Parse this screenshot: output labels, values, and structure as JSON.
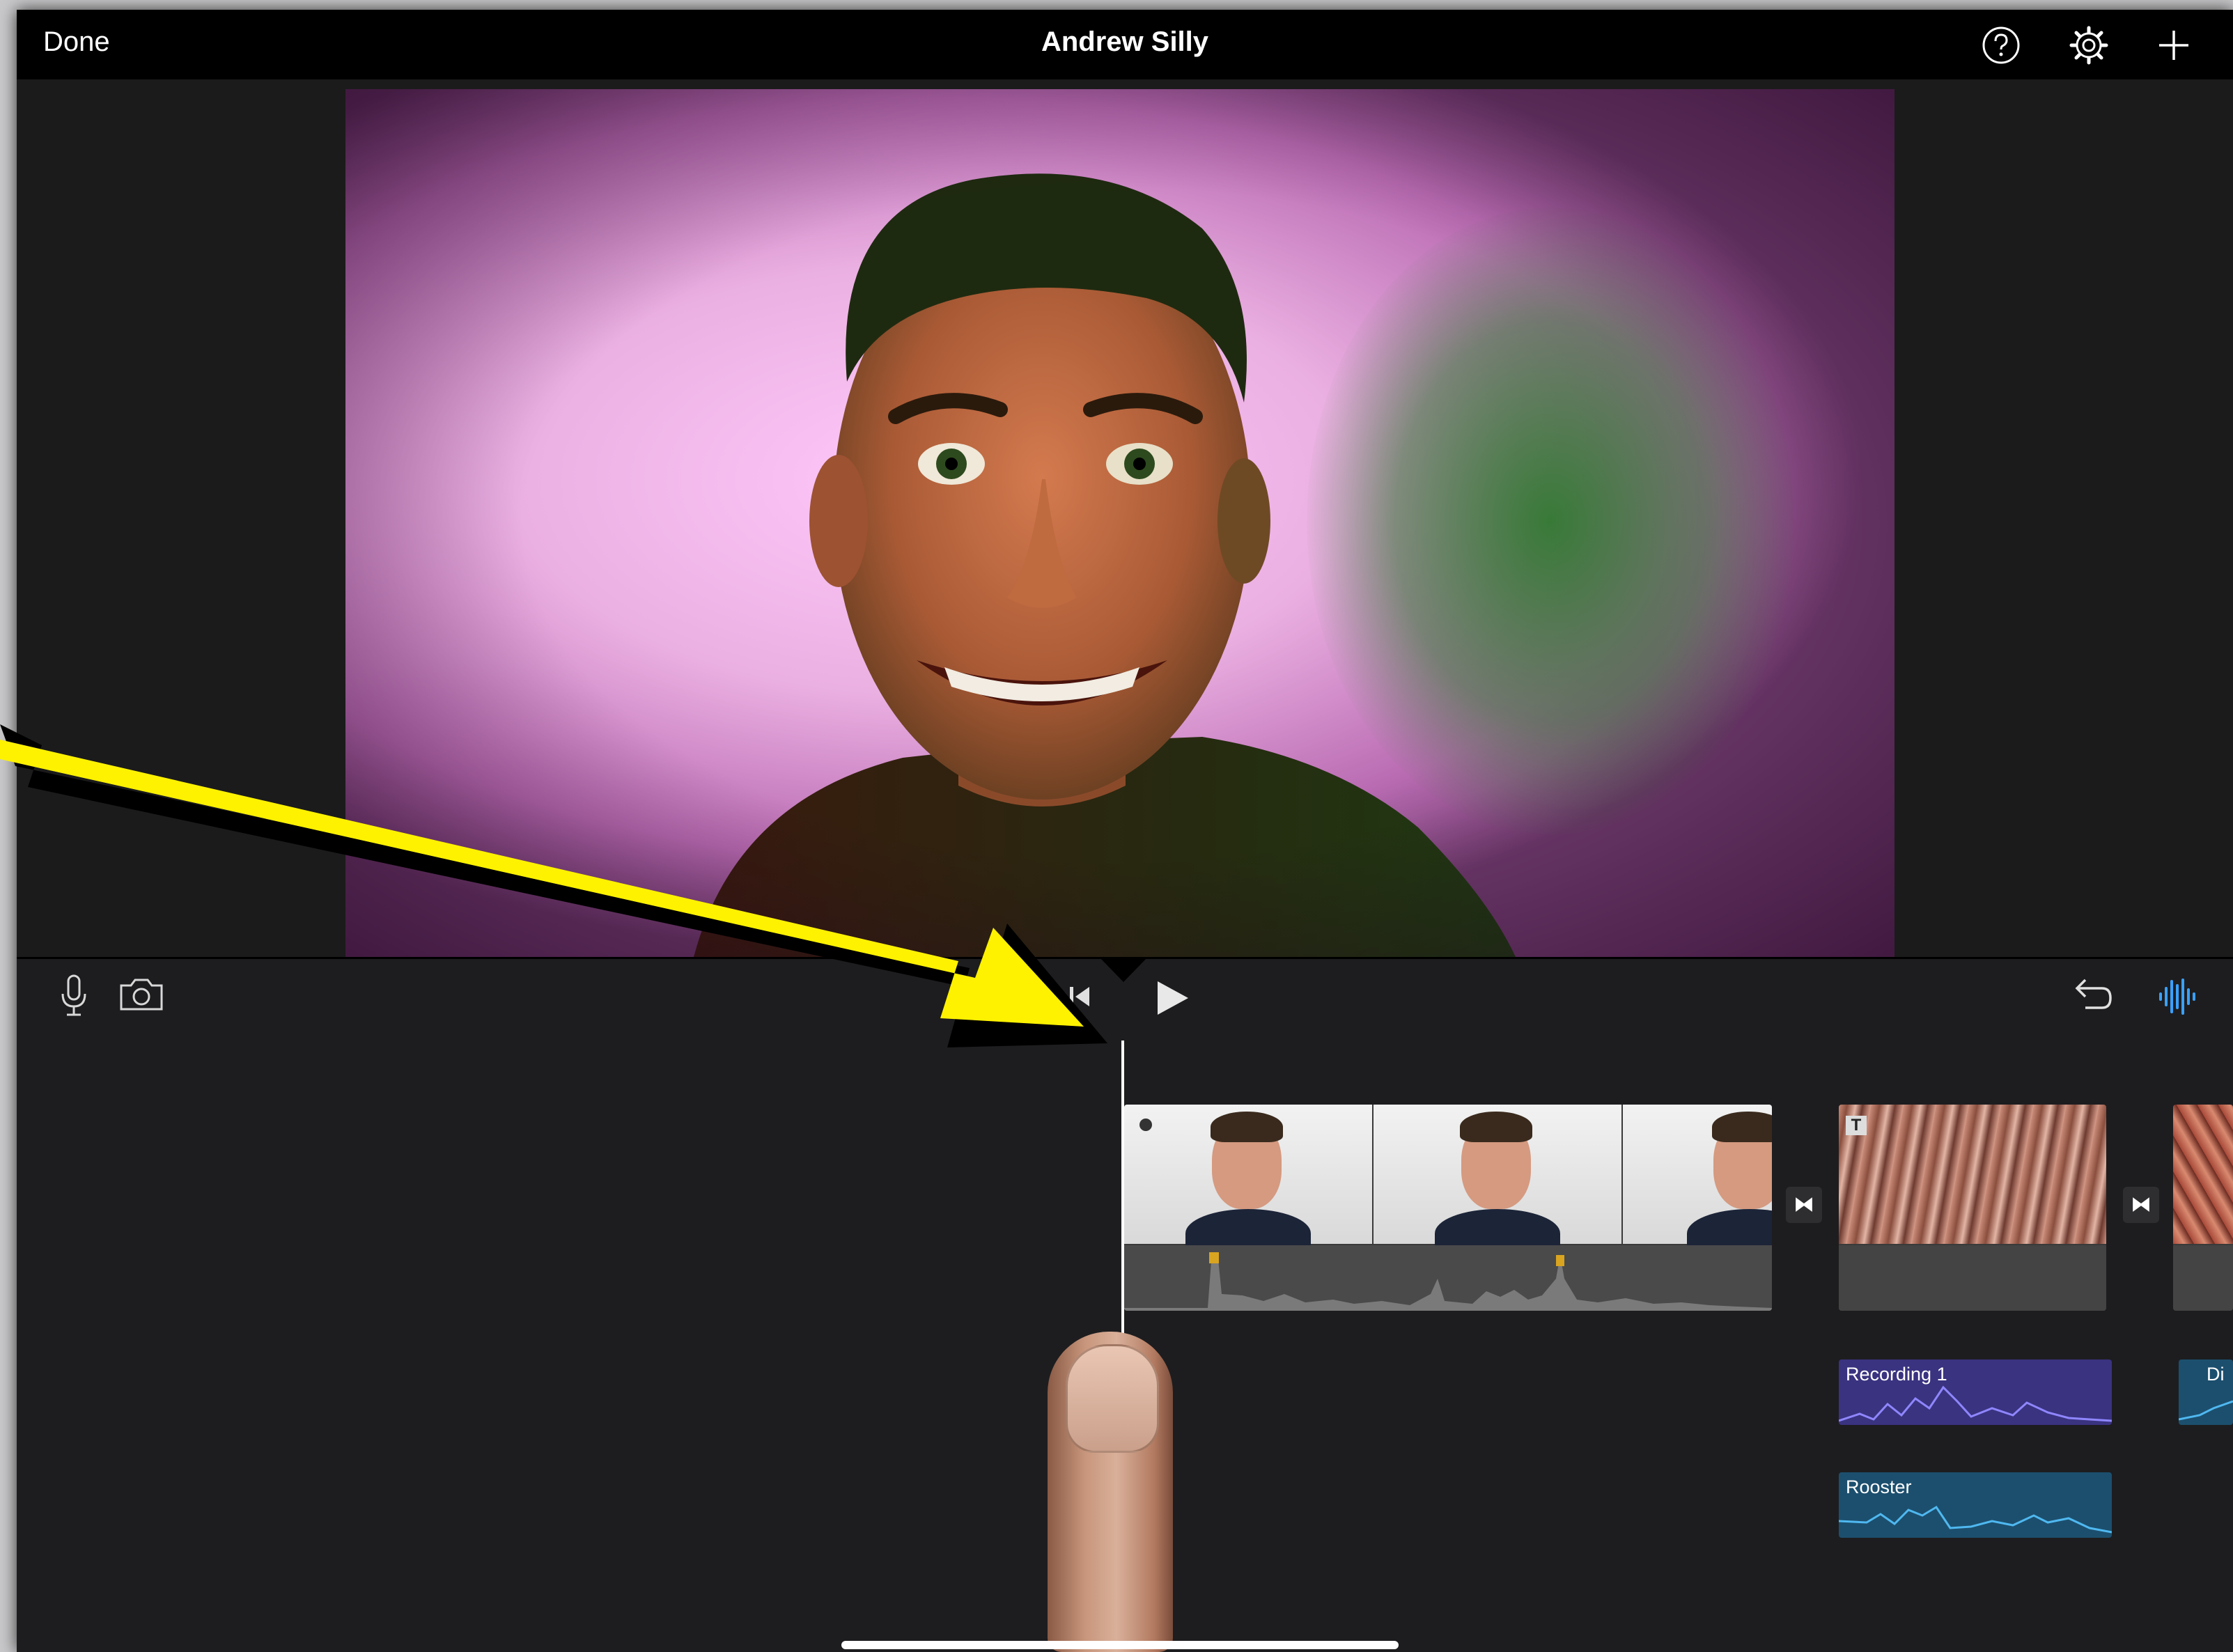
{
  "header": {
    "done_label": "Done",
    "project_title": "Andrew Silly",
    "icons": [
      "help-icon",
      "settings-gear-icon",
      "add-plus-icon"
    ]
  },
  "controls": {
    "icons": [
      "microphone-icon",
      "camera-icon",
      "skip-to-start-icon",
      "play-icon",
      "undo-icon",
      "audio-waveform-icon"
    ],
    "accent_color": "#3aa0ff"
  },
  "timeline": {
    "audio_clips": [
      {
        "label": "Recording 1",
        "color": "#3a3380"
      },
      {
        "label": "Rooster",
        "color": "#1c4f6e"
      },
      {
        "label": "Di",
        "color": "#1c4f6e"
      }
    ]
  },
  "annotation": {
    "arrow_color": "#fff200"
  }
}
